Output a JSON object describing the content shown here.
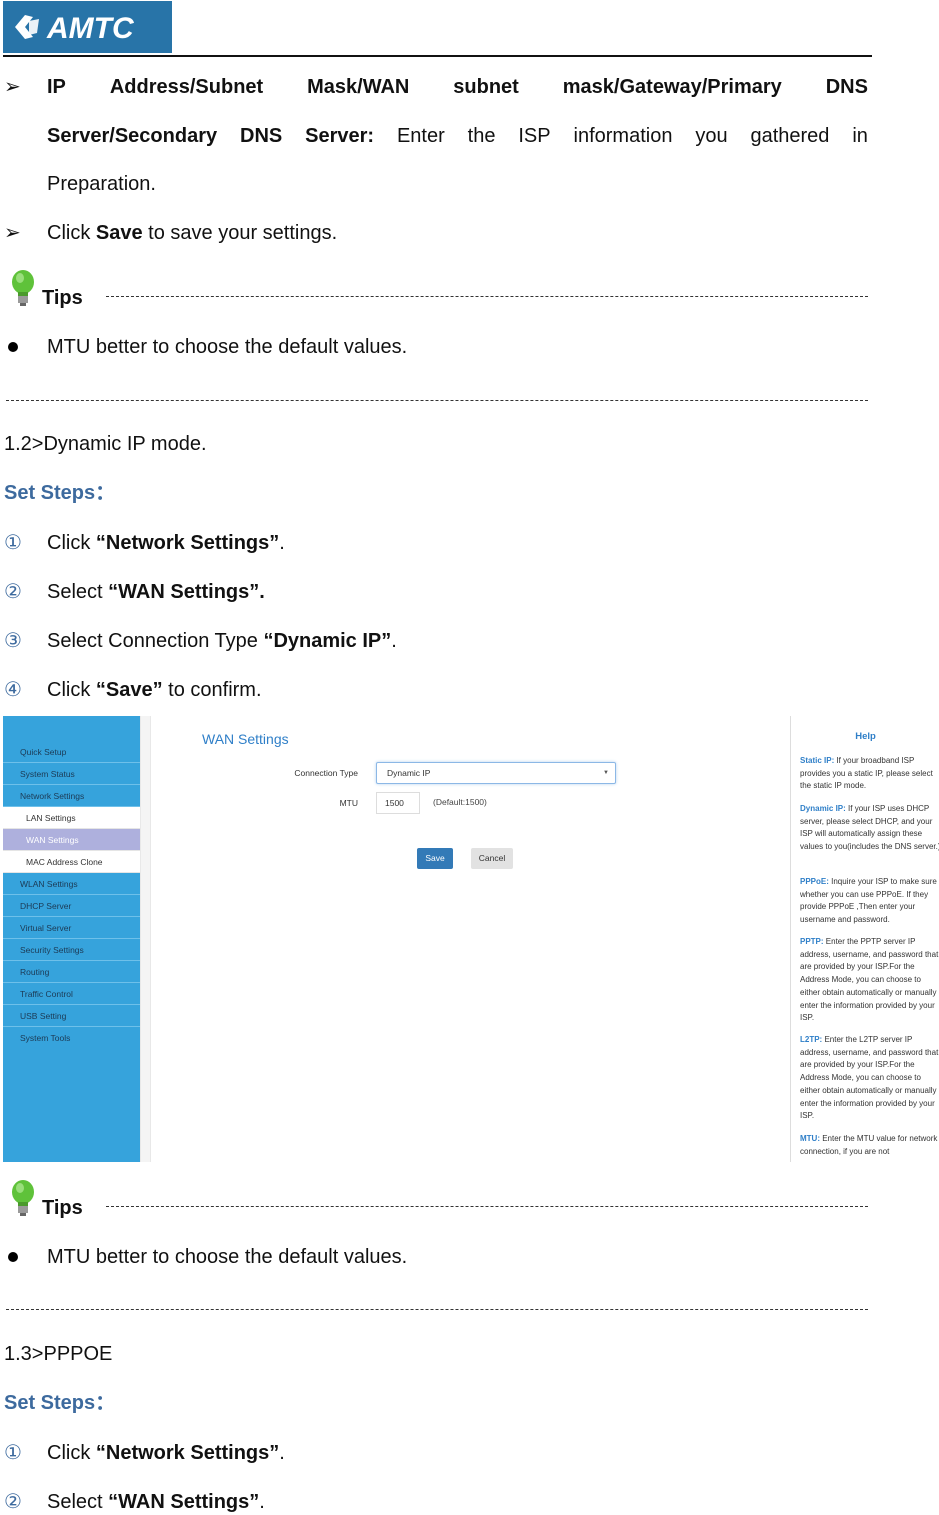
{
  "header": {
    "logo_text": "AMTC",
    "logo_color": "#2874a8"
  },
  "static_section": {
    "item1_words_line1": [
      "IP",
      "Address/Subnet",
      "Mask/WAN",
      "subnet",
      "mask/Gateway/Primary",
      "DNS"
    ],
    "item1_line2_bold": [
      "Server/Secondary",
      "DNS",
      "Server:"
    ],
    "item1_line2_rest": [
      "Enter",
      "the",
      "ISP",
      "information",
      "you",
      "gathered",
      "in"
    ],
    "item1_line3": "Preparation.",
    "item2_pre": "Click ",
    "item2_bold": "Save",
    "item2_post": " to save your settings."
  },
  "tips1": {
    "label": "Tips",
    "text": "MTU better to choose the default values."
  },
  "dynamic_section": {
    "heading": "1.2>Dynamic IP mode.",
    "set_steps": "Set Steps：",
    "steps": [
      {
        "num": "①",
        "pre": "Click ",
        "bold": "“Network Settings”",
        "post": "."
      },
      {
        "num": "②",
        "pre": "Select ",
        "bold": "“WAN Settings”.",
        "post": ""
      },
      {
        "num": "③",
        "pre": "Select Connection Type ",
        "bold": "“Dynamic IP”",
        "post": "."
      },
      {
        "num": "④",
        "pre": "Click ",
        "bold": "“Save”",
        "post": " to confirm."
      }
    ]
  },
  "screenshot": {
    "sidebar": [
      {
        "label": "Quick Setup",
        "type": "main"
      },
      {
        "label": "System Status",
        "type": "main"
      },
      {
        "label": "Network Settings",
        "type": "main"
      },
      {
        "label": "LAN Settings",
        "type": "sub"
      },
      {
        "label": "WAN Settings",
        "type": "sub-active"
      },
      {
        "label": "MAC Address Clone",
        "type": "sub"
      },
      {
        "label": "WLAN Settings",
        "type": "main"
      },
      {
        "label": "DHCP Server",
        "type": "main"
      },
      {
        "label": "Virtual Server",
        "type": "main"
      },
      {
        "label": "Security Settings",
        "type": "main"
      },
      {
        "label": "Routing",
        "type": "main"
      },
      {
        "label": "Traffic Control",
        "type": "main"
      },
      {
        "label": "USB Setting",
        "type": "main"
      },
      {
        "label": "System Tools",
        "type": "main"
      }
    ],
    "title": "WAN Settings",
    "connection_type_label": "Connection Type",
    "connection_type_value": "Dynamic IP",
    "mtu_label": "MTU",
    "mtu_value": "1500",
    "mtu_hint": "(Default:1500)",
    "save_label": "Save",
    "cancel_label": "Cancel",
    "help": {
      "title": "Help",
      "entries": [
        {
          "key": "Static IP:",
          "text": " If your broadband ISP provides you a static IP, please select the static IP mode."
        },
        {
          "key": "Dynamic IP:",
          "text": " If your ISP uses DHCP server, please select DHCP, and your ISP will automatically assign these values to you(includes the DNS server.)"
        },
        {
          "key": "PPPoE:",
          "text": " Inquire your ISP to make sure whether you can use PPPoE. If they provide PPPoE ,Then enter your username and password."
        },
        {
          "key": "PPTP:",
          "text": " Enter the PPTP server IP address, username, and password that are provided by your ISP.For the Address Mode, you can choose to either obtain automatically or manually enter the information provided by your ISP."
        },
        {
          "key": "L2TP:",
          "text": " Enter the L2TP server IP address, username, and password that are provided by your ISP.For the Address Mode, you can choose to either obtain automatically or manually enter the information provided by your ISP."
        },
        {
          "key": "MTU:",
          "text": " Enter the MTU value for network connection, if you are not"
        }
      ]
    }
  },
  "tips2": {
    "label": "Tips",
    "text": "MTU better to choose the default values."
  },
  "pppoe_section": {
    "heading": "1.3>PPPOE",
    "set_steps": "Set Steps：",
    "steps": [
      {
        "num": "①",
        "pre": "Click ",
        "bold": "“Network Settings”",
        "post": "."
      },
      {
        "num": "②",
        "pre": "Select ",
        "bold": "“WAN Settings”",
        "post": "."
      }
    ]
  },
  "colors": {
    "heading_blue": "#3d6a9e",
    "sidebar_blue": "#36a3dc",
    "sidebar_active": "#aeb0dd",
    "link_blue": "#2f7fc8",
    "save_button": "#337ab7"
  }
}
